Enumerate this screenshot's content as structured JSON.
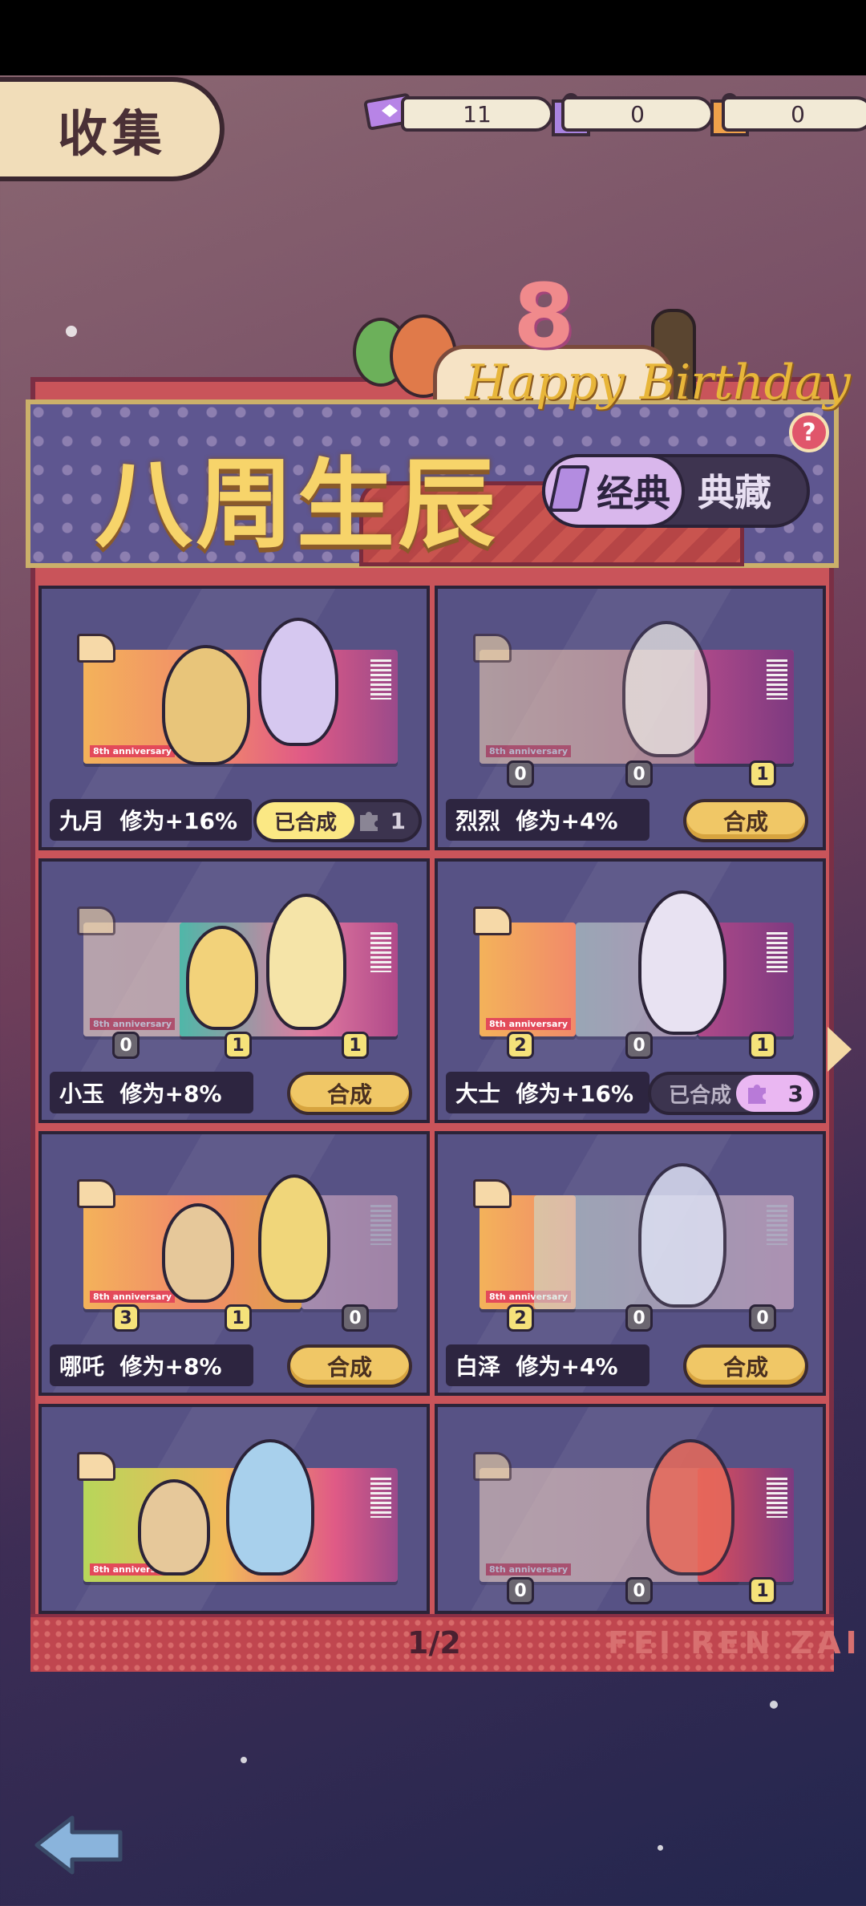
{
  "header": {
    "title": "收集",
    "resources": [
      {
        "icon": "ticket-icon",
        "value": "11"
      },
      {
        "icon": "purple-puzzle-icon",
        "value": "0"
      },
      {
        "icon": "orange-puzzle-icon",
        "value": "0"
      }
    ]
  },
  "banner": {
    "title": "八周生辰",
    "cake_number": "8",
    "cake_text": "Happy Birthday",
    "help": "?",
    "tabs": [
      {
        "label": "经典",
        "selected": true
      },
      {
        "label": "典藏",
        "selected": false
      }
    ]
  },
  "cards": [
    {
      "name": "九月",
      "bonus": "修为+16%",
      "status": "merged",
      "merged_label": "已合成",
      "merged_count": "1",
      "pieces": []
    },
    {
      "name": "烈烈",
      "bonus": "修为+4%",
      "status": "merge",
      "button_label": "合成",
      "pieces": [
        "0",
        "0",
        "1"
      ]
    },
    {
      "name": "小玉",
      "bonus": "修为+8%",
      "status": "merge",
      "button_label": "合成",
      "pieces": [
        "0",
        "1",
        "1"
      ]
    },
    {
      "name": "大士",
      "bonus": "修为+16%",
      "status": "merged",
      "merged_label": "已合成",
      "merged_count": "3",
      "pieces": [
        "2",
        "0",
        "1"
      ]
    },
    {
      "name": "哪吒",
      "bonus": "修为+8%",
      "status": "merge",
      "button_label": "合成",
      "pieces": [
        "3",
        "1",
        "0"
      ]
    },
    {
      "name": "白泽",
      "bonus": "修为+4%",
      "status": "merge",
      "button_label": "合成",
      "pieces": [
        "2",
        "0",
        "0"
      ]
    },
    {
      "name": "",
      "bonus": "",
      "status": "none",
      "pieces": []
    },
    {
      "name": "",
      "bonus": "",
      "status": "none",
      "pieces": [
        "0",
        "0",
        "1"
      ]
    }
  ],
  "ticket_caption": "8th anniversary",
  "pagination": {
    "page": "1/2"
  },
  "brand": "FEI REN ZAI",
  "colors": {
    "accent_gold": "#f0c766",
    "panel_purple": "#575285",
    "frame_red": "#c9545a"
  }
}
